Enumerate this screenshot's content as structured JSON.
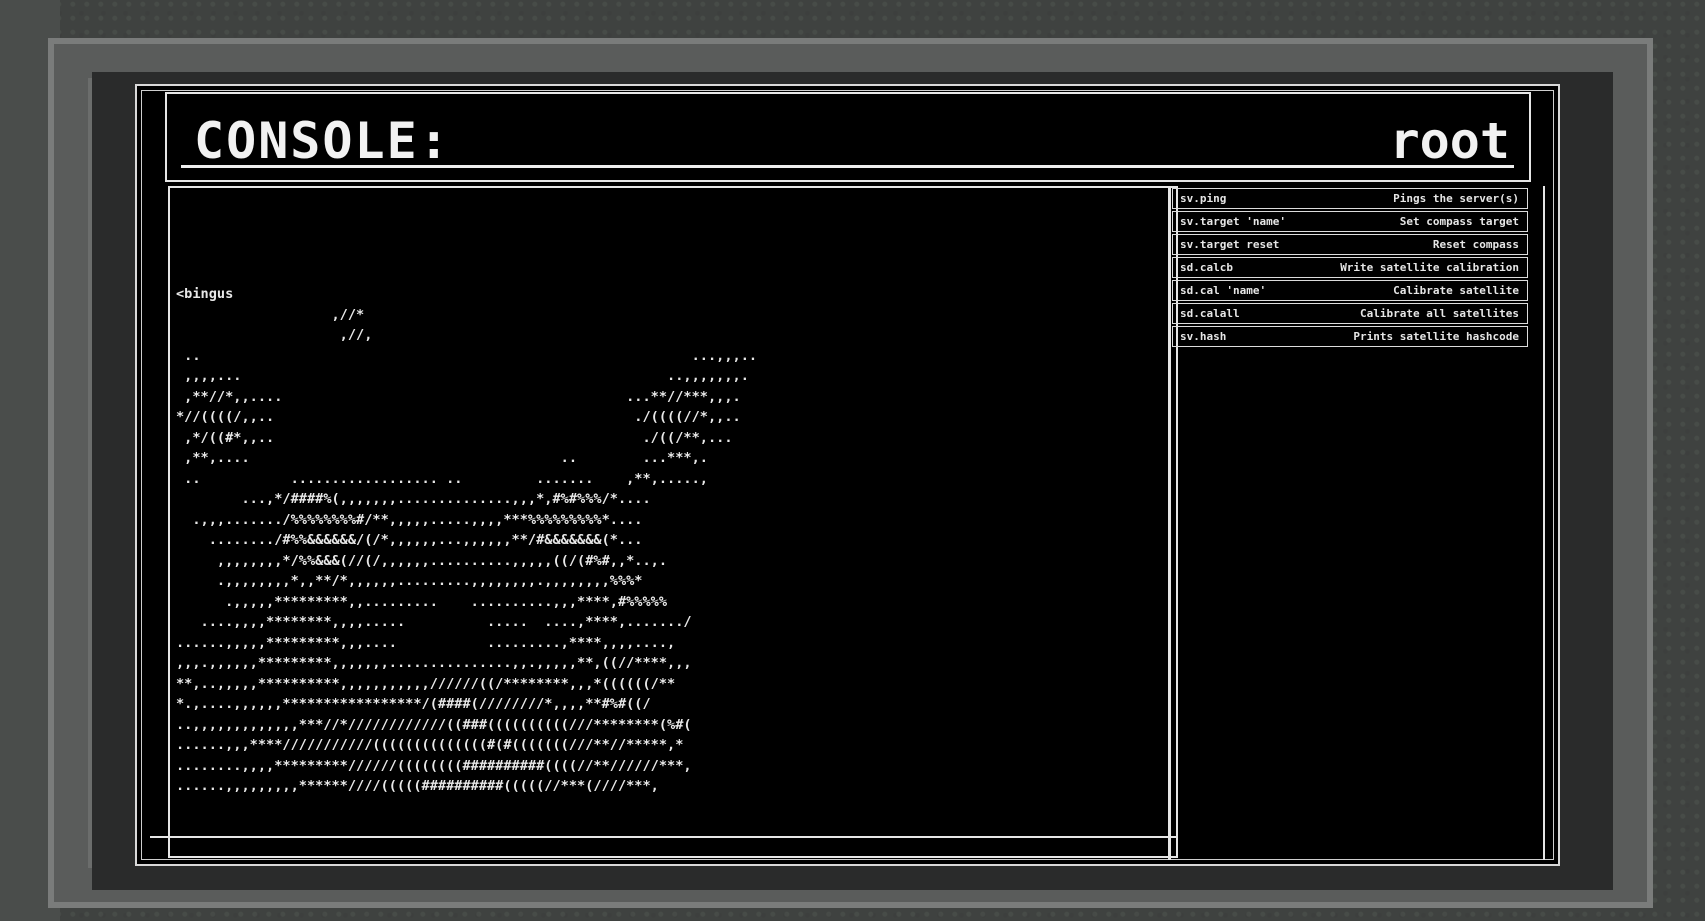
{
  "header": {
    "title": "CONSOLE:",
    "user": "root"
  },
  "console": {
    "lines": [
      "<bingus",
      "                   ,//*",
      "                    ,//,",
      " ..                                                            ...,,,..",
      " ,,,,...                                                    ..,,,,,,,.",
      " ,**//*,,....                                          ...**//***,,,.",
      "*//((((/,,..                                            ./((((//*,,..",
      " ,*/((#*,,..                                             ./((/**,...",
      " ,**,....                                      ..        ...***,.",
      " ..           .................. ..         .......    ,**,.....,",
      "        ...,*/####%(,,,,,,,..............,,,*,#%#%%%/*....",
      "  .,,,......./%%%%%%%%#/**,,,,,.....,,,,***%%%%%%%%%*....",
      "    ......../#%%&&&&&&/(/*,,,,,,...,,,,,,**/#&&&&&&&(*...",
      "     ,,,,,,,,*/%%&&&(//(/,,,,,,..........,,,,,((/(#%#,,*..,.",
      "     .,,,,,,,,*,,**/*,,,,,,.........,,,,,,,,.,,,,,,,,%%%*",
      "      .,,,,,*********,,.........    ..........,,,****,#%%%%%",
      "   ....,,,,********,,,,.....          .....  ....,****,......./",
      "......,,,,,*********,,,....           .........,****,,,,....,",
      ",,,.,,,,,,*********,,,,,,,...............,,.,,,,,**,((//****,,,",
      "**,..,,,,,**********,,,,,,,,,,,//////((/********,,,*((((((/**",
      "*.,....,,,,,,*****************/(####(////////*,,,,**#%#((/",
      "..,,,,,,,,,,,,,***//*////////////((###((((((((((///********(%#(",
      "......,,,****///////////((((((((((((((#(#(((((((///**//*****,*",
      "........,,,,*********//////((((((((##########((((//**//////***,",
      "......,,,,,,,,,******////(((((##########(((((//***(////***,"
    ]
  },
  "commands": [
    {
      "cmd": "sv.ping",
      "desc": "Pings the server(s)"
    },
    {
      "cmd": "sv.target 'name'",
      "desc": "Set compass target"
    },
    {
      "cmd": "sv.target reset",
      "desc": "Reset compass"
    },
    {
      "cmd": "sd.calcb",
      "desc": "Write satellite calibration"
    },
    {
      "cmd": "sd.cal 'name'",
      "desc": "Calibrate satellite"
    },
    {
      "cmd": "sd.calall",
      "desc": "Calibrate all satellites"
    },
    {
      "cmd": "sv.hash",
      "desc": "Prints satellite hashcode"
    }
  ]
}
